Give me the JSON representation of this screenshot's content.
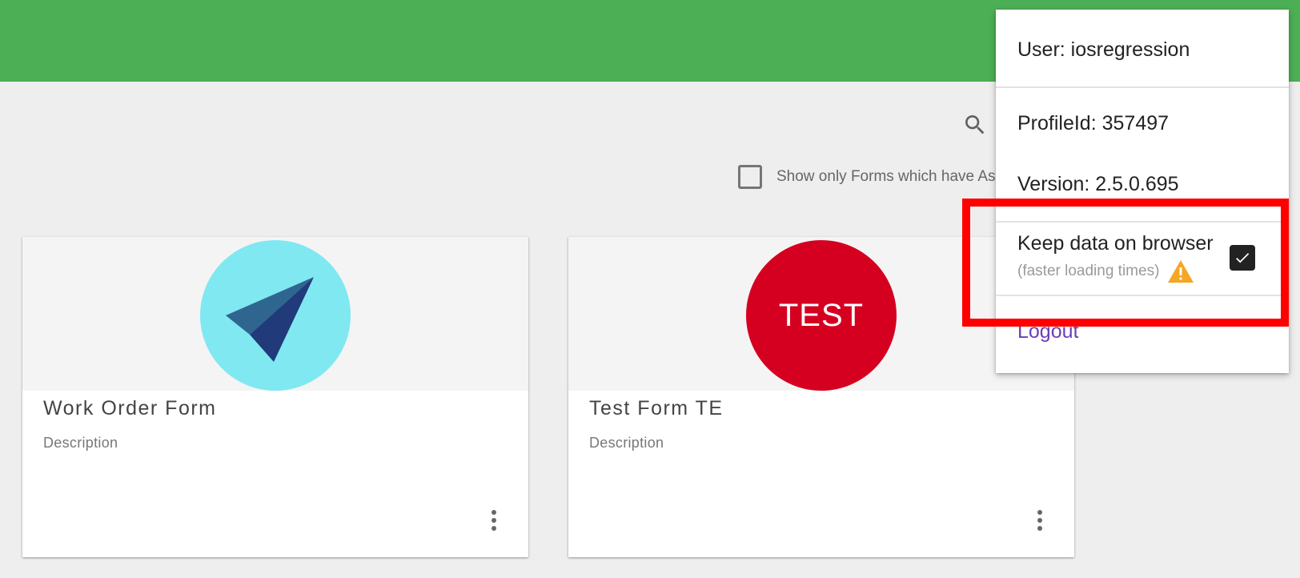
{
  "filter": {
    "label": "Show only Forms which have As",
    "checked": false
  },
  "search": {
    "icon": "search-icon"
  },
  "cards": [
    {
      "title": "Work Order Form",
      "description": "Description",
      "avatar_icon": "paper-plane-icon",
      "avatar_color": "#80e8f0"
    },
    {
      "title": "Test Form TE",
      "description": "Description",
      "avatar_text": "TEST",
      "avatar_color": "#d50020"
    }
  ],
  "menu": {
    "user": "User: iosregression",
    "profile": "ProfileId: 357497",
    "version": "Version: 2.5.0.695",
    "keep_data_label": "Keep data on browser",
    "keep_data_sub": "(faster loading times)",
    "keep_data_checked": true,
    "logout": "Logout"
  },
  "colors": {
    "topbar": "#4caf55",
    "highlight": "#ff0000",
    "logout": "#6a3fb5",
    "warning": "#f5a623"
  }
}
